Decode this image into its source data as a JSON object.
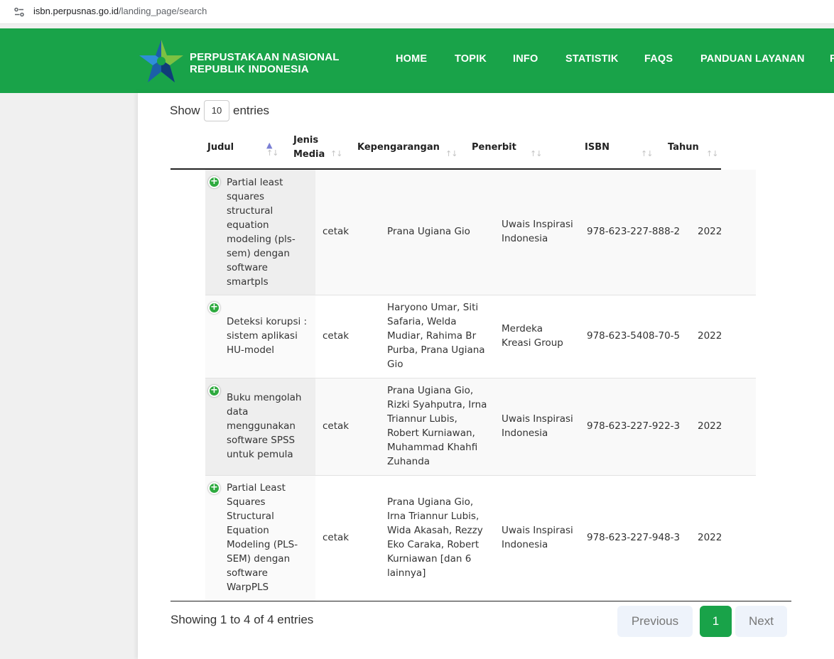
{
  "browser": {
    "url_host": "isbn.perpusnas.go.id",
    "url_path": "/landing_page/search"
  },
  "header": {
    "logo_line1": "PERPUSTAKAAN NASIONAL",
    "logo_line2": "REPUBLIK INDONESIA",
    "nav": [
      "HOME",
      "TOPIK",
      "INFO",
      "STATISTIK",
      "FAQS",
      "PANDUAN LAYANAN",
      "F"
    ],
    "brand_color": "#19a349"
  },
  "controls": {
    "show_label": "Show",
    "entries_value": "10",
    "entries_label": "entries"
  },
  "table": {
    "columns": {
      "judul": "Judul",
      "jenis_1": "Jenis",
      "jenis_2": "Media",
      "kepengarangan": "Kepengarangan",
      "penerbit": "Penerbit",
      "isbn": "ISBN",
      "tahun": "Tahun"
    },
    "rows": [
      {
        "judul": [
          "Partial least",
          "squares",
          "structural",
          "equation",
          "modeling (pls-",
          "sem) dengan",
          "software",
          "smartpls"
        ],
        "media": "cetak",
        "kepengarangan": [
          "Prana Ugiana Gio"
        ],
        "penerbit": [
          "Uwais Inspirasi",
          "Indonesia"
        ],
        "isbn": "978-623-227-888-2",
        "tahun": "2022"
      },
      {
        "judul": [
          "Deteksi korupsi :",
          "sistem aplikasi",
          "HU-model"
        ],
        "media": "cetak",
        "kepengarangan": [
          "Haryono Umar, Siti",
          "Safaria, Welda",
          "Mudiar, Rahima Br",
          "Purba, Prana Ugiana",
          "Gio"
        ],
        "penerbit": [
          "Merdeka",
          "Kreasi Group"
        ],
        "isbn": "978-623-5408-70-5",
        "tahun": "2022"
      },
      {
        "judul": [
          "Buku mengolah",
          "data",
          "menggunakan",
          "software SPSS",
          "untuk pemula"
        ],
        "media": "cetak",
        "kepengarangan": [
          "Prana Ugiana Gio,",
          "Rizki Syahputra, Irna",
          "Triannur Lubis,",
          "Robert Kurniawan,",
          "Muhammad Khahfi",
          "Zuhanda"
        ],
        "penerbit": [
          "Uwais Inspirasi",
          "Indonesia"
        ],
        "isbn": "978-623-227-922-3",
        "tahun": "2022"
      },
      {
        "judul": [
          "Partial Least",
          "Squares",
          "Structural",
          "Equation",
          "Modeling (PLS-",
          "SEM) dengan",
          "software",
          "WarpPLS"
        ],
        "media": "cetak",
        "kepengarangan": [
          "Prana Ugiana Gio,",
          "Irna Triannur Lubis,",
          "Wida Akasah, Rezzy",
          "Eko Caraka, Robert",
          "Kurniawan [dan 6",
          "lainnya]"
        ],
        "penerbit": [
          "Uwais Inspirasi",
          "Indonesia"
        ],
        "isbn": "978-623-227-948-3",
        "tahun": "2022"
      }
    ]
  },
  "footer": {
    "info": "Showing 1 to 4 of 4 entries",
    "prev": "Previous",
    "page": "1",
    "next": "Next"
  }
}
